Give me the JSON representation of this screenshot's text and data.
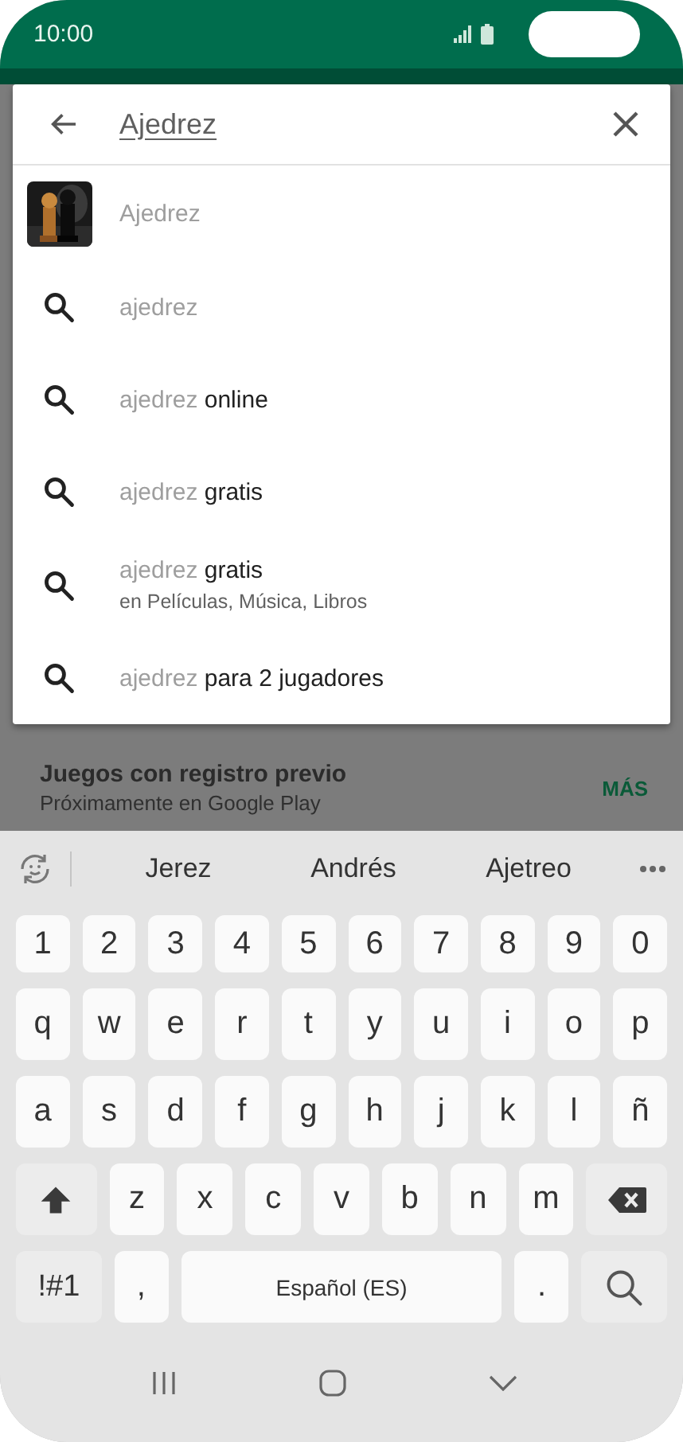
{
  "status_bar": {
    "time": "10:00"
  },
  "search": {
    "value": "Ajedrez"
  },
  "suggestions": [
    {
      "kind": "app",
      "text": "Ajedrez"
    },
    {
      "kind": "query",
      "typed": "ajedrez"
    },
    {
      "kind": "query",
      "typed": "ajedrez",
      "rest": "online"
    },
    {
      "kind": "query",
      "typed": "ajedrez",
      "rest": "gratis"
    },
    {
      "kind": "query",
      "typed": "ajedrez",
      "rest": "gratis",
      "subtitle": "en Películas, Música, Libros"
    },
    {
      "kind": "query",
      "typed": "ajedrez",
      "rest": "para 2 jugadores"
    }
  ],
  "background_section": {
    "title": "Juegos con registro previo",
    "subtitle": "Próximamente en Google Play",
    "action": "MÁS"
  },
  "keyboard": {
    "predictions": [
      "Jerez",
      "Andrés",
      "Ajetreo"
    ],
    "key_rows": [
      {
        "keys": [
          {
            "kind": "char",
            "label": "1"
          },
          {
            "kind": "char",
            "label": "2"
          },
          {
            "kind": "char",
            "label": "3"
          },
          {
            "kind": "char",
            "label": "4"
          },
          {
            "kind": "char",
            "label": "5"
          },
          {
            "kind": "char",
            "label": "6"
          },
          {
            "kind": "char",
            "label": "7"
          },
          {
            "kind": "char",
            "label": "8"
          },
          {
            "kind": "char",
            "label": "9"
          },
          {
            "kind": "char",
            "label": "0"
          }
        ]
      },
      {
        "keys": [
          {
            "kind": "char",
            "label": "q"
          },
          {
            "kind": "char",
            "label": "w"
          },
          {
            "kind": "char",
            "label": "e"
          },
          {
            "kind": "char",
            "label": "r"
          },
          {
            "kind": "char",
            "label": "t"
          },
          {
            "kind": "char",
            "label": "y"
          },
          {
            "kind": "char",
            "label": "u"
          },
          {
            "kind": "char",
            "label": "i"
          },
          {
            "kind": "char",
            "label": "o"
          },
          {
            "kind": "char",
            "label": "p"
          }
        ]
      },
      {
        "keys": [
          {
            "kind": "char",
            "label": "a"
          },
          {
            "kind": "char",
            "label": "s"
          },
          {
            "kind": "char",
            "label": "d"
          },
          {
            "kind": "char",
            "label": "f"
          },
          {
            "kind": "char",
            "label": "g"
          },
          {
            "kind": "char",
            "label": "h"
          },
          {
            "kind": "char",
            "label": "j"
          },
          {
            "kind": "char",
            "label": "k"
          },
          {
            "kind": "char",
            "label": "l"
          },
          {
            "kind": "char",
            "label": "ñ"
          }
        ]
      },
      {
        "keys": [
          {
            "kind": "shift"
          },
          {
            "kind": "char",
            "label": "z"
          },
          {
            "kind": "char",
            "label": "x"
          },
          {
            "kind": "char",
            "label": "c"
          },
          {
            "kind": "char",
            "label": "v"
          },
          {
            "kind": "char",
            "label": "b"
          },
          {
            "kind": "char",
            "label": "n"
          },
          {
            "kind": "char",
            "label": "m"
          },
          {
            "kind": "backspace"
          }
        ]
      },
      {
        "keys": [
          {
            "kind": "symbols",
            "label": "!#1"
          },
          {
            "kind": "char",
            "label": ","
          },
          {
            "kind": "space",
            "label": "Español (ES)"
          },
          {
            "kind": "char",
            "label": "."
          },
          {
            "kind": "search"
          }
        ]
      }
    ]
  }
}
